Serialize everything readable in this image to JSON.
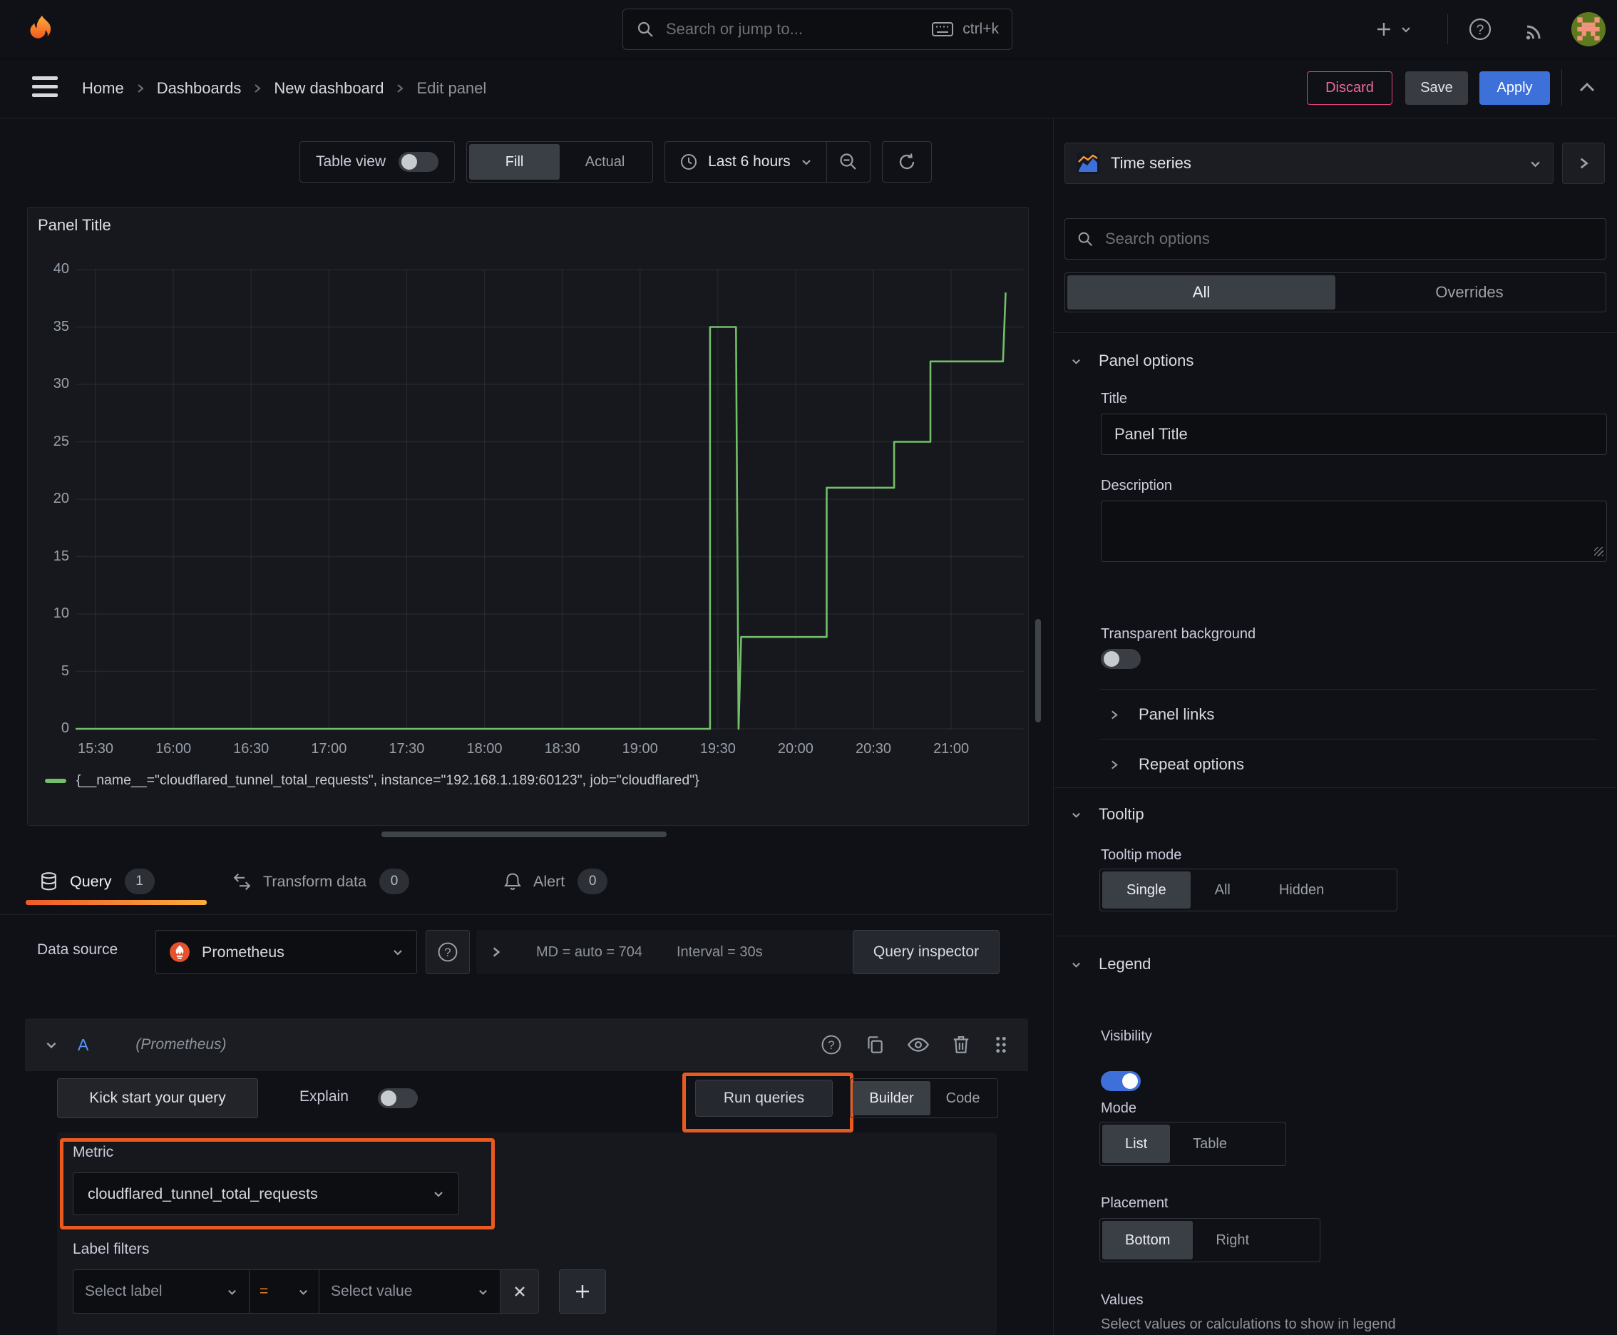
{
  "topbar": {
    "search_placeholder": "Search or jump to...",
    "shortcut": "ctrl+k"
  },
  "breadcrumb": {
    "items": [
      "Home",
      "Dashboards",
      "New dashboard",
      "Edit panel"
    ]
  },
  "actions": {
    "discard": "Discard",
    "save": "Save",
    "apply": "Apply"
  },
  "toolbar": {
    "table_view": "Table view",
    "fill": "Fill",
    "actual": "Actual",
    "time_range": "Last 6 hours"
  },
  "viz_picker": {
    "label": "Time series"
  },
  "options_search": {
    "placeholder": "Search options",
    "tab_all": "All",
    "tab_overrides": "Overrides"
  },
  "panel_options": {
    "header": "Panel options",
    "title_label": "Title",
    "title_value": "Panel Title",
    "description_label": "Description",
    "transparent_label": "Transparent background",
    "panel_links": "Panel links",
    "repeat_options": "Repeat options"
  },
  "tooltip_section": {
    "header": "Tooltip",
    "mode_label": "Tooltip mode",
    "single": "Single",
    "all": "All",
    "hidden": "Hidden"
  },
  "legend_section": {
    "header": "Legend",
    "visibility_label": "Visibility",
    "mode_label": "Mode",
    "list": "List",
    "table": "Table",
    "placement_label": "Placement",
    "bottom": "Bottom",
    "right": "Right",
    "values_label": "Values",
    "values_help": "Select values or calculations to show in legend"
  },
  "tabs": {
    "query": "Query",
    "query_count": "1",
    "transform": "Transform data",
    "transform_count": "0",
    "alert": "Alert",
    "alert_count": "0"
  },
  "datasource": {
    "label": "Data source",
    "name": "Prometheus",
    "meta": "MD = auto = 704",
    "interval": "Interval = 30s",
    "inspector": "Query inspector"
  },
  "query_editor": {
    "ref_id": "A",
    "ds_hint": "(Prometheus)",
    "kickstart": "Kick start your query",
    "explain": "Explain",
    "run": "Run queries",
    "builder": "Builder",
    "code": "Code",
    "metric_label": "Metric",
    "metric_value": "cloudflared_tunnel_total_requests",
    "label_filters_label": "Label filters",
    "select_label": "Select label",
    "operator": "=",
    "select_value": "Select value"
  },
  "chart_data": {
    "type": "line",
    "render": "step",
    "title": "Panel Title",
    "ylim": [
      0,
      40
    ],
    "yticks": [
      0,
      5,
      10,
      15,
      20,
      25,
      30,
      35,
      40
    ],
    "xticks": [
      "15:30",
      "16:00",
      "16:30",
      "17:00",
      "17:30",
      "18:00",
      "18:30",
      "19:00",
      "19:30",
      "20:00",
      "20:30",
      "21:00"
    ],
    "x_range": [
      "15:22",
      "21:28"
    ],
    "grid": true,
    "legend_position": "bottom",
    "series": [
      {
        "name": "{__name__=\"cloudflared_tunnel_total_requests\", instance=\"192.168.1.189:60123\", job=\"cloudflared\"}",
        "color": "#73bf69",
        "points": [
          [
            "15:22",
            0
          ],
          [
            "19:27",
            0
          ],
          [
            "19:27",
            35
          ],
          [
            "19:37",
            35
          ],
          [
            "19:38",
            0
          ],
          [
            "19:39",
            8
          ],
          [
            "20:12",
            8
          ],
          [
            "20:12",
            21
          ],
          [
            "20:38",
            21
          ],
          [
            "20:38",
            25
          ],
          [
            "20:52",
            25
          ],
          [
            "20:52",
            32
          ],
          [
            "21:20",
            32
          ],
          [
            "21:21",
            38
          ]
        ]
      }
    ]
  }
}
